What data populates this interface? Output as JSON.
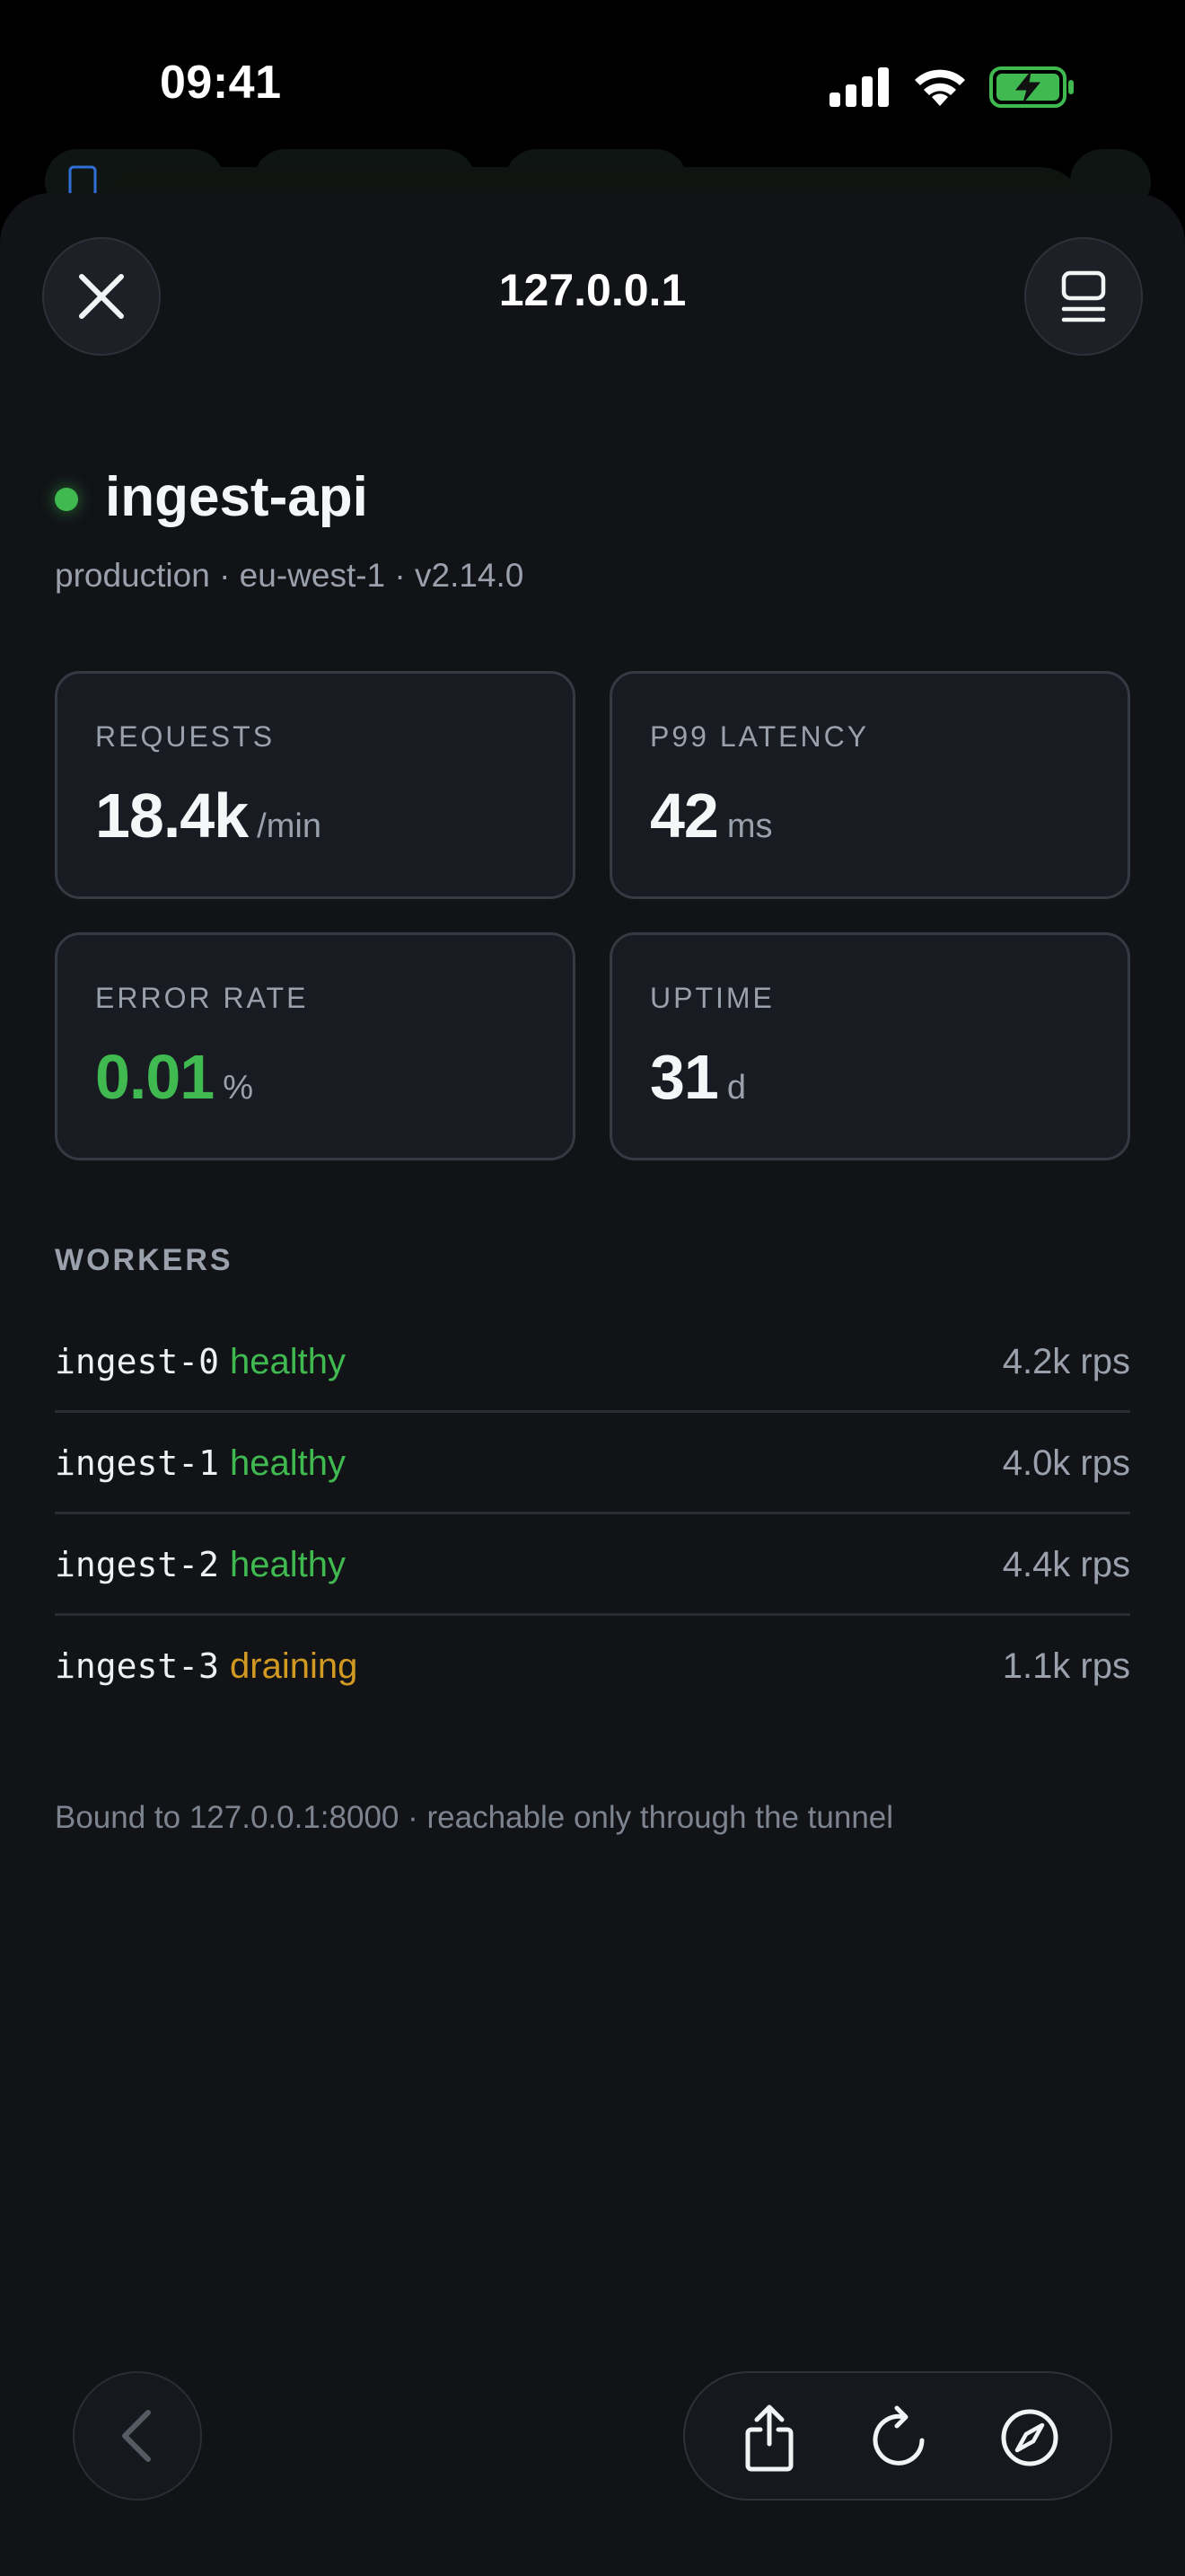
{
  "status_bar": {
    "time": "09:41",
    "battery_color": "#3fb950"
  },
  "sheet": {
    "title": "127.0.0.1",
    "close_icon": "close-icon",
    "reader_icon": "reader-mode-icon"
  },
  "service": {
    "name": "ingest-api",
    "status_color": "#3fb950",
    "meta": "production · eu-west-1 · v2.14.0"
  },
  "stats": {
    "requests": {
      "label": "REQUESTS",
      "value": "18.4k",
      "unit": "/min"
    },
    "latency": {
      "label": "P99 LATENCY",
      "value": "42",
      "unit": "ms"
    },
    "error_rate": {
      "label": "ERROR RATE",
      "value": "0.01",
      "unit": "%",
      "color": "#3fb950"
    },
    "uptime": {
      "label": "UPTIME",
      "value": "31",
      "unit": "d"
    }
  },
  "workers": {
    "label": "WORKERS",
    "items": [
      {
        "name": "ingest-0",
        "state": "healthy",
        "rps": "4.2k rps"
      },
      {
        "name": "ingest-1",
        "state": "healthy",
        "rps": "4.0k rps"
      },
      {
        "name": "ingest-2",
        "state": "healthy",
        "rps": "4.4k rps"
      },
      {
        "name": "ingest-3",
        "state": "draining",
        "rps": "1.1k rps"
      }
    ]
  },
  "footnote": "Bound to 127.0.0.1:8000 · reachable only through the tunnel",
  "toolbar": {
    "back_icon": "chevron-left-icon",
    "share_icon": "share-icon",
    "reload_icon": "reload-icon",
    "safari_icon": "compass-icon"
  }
}
